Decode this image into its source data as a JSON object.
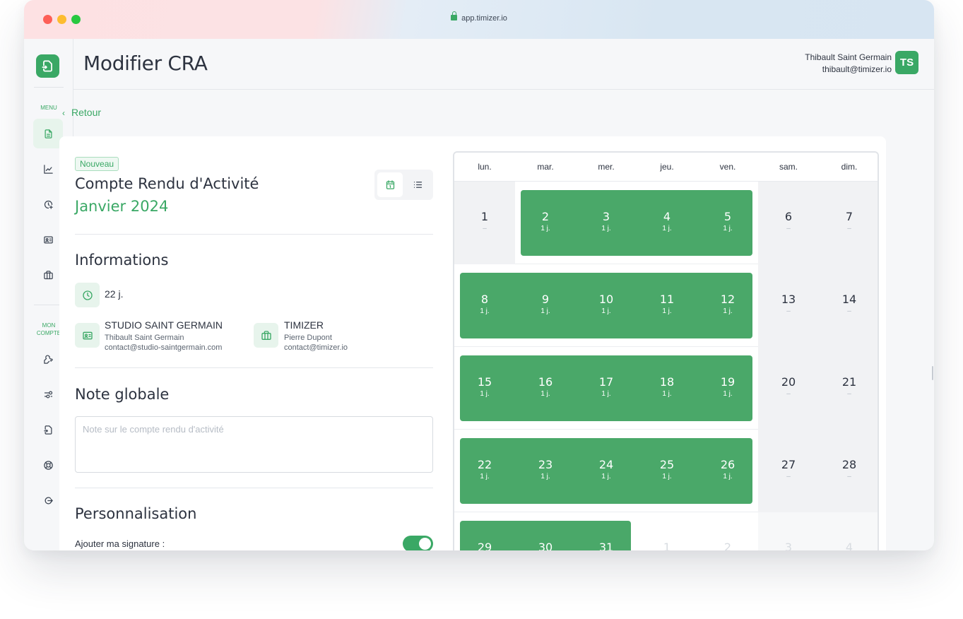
{
  "browser": {
    "url": "app.timizer.io"
  },
  "sidebar": {
    "menu_label": "MENU",
    "account_label_line1": "MON",
    "account_label_line2": "COMPTE",
    "menu_icons": [
      "document-icon",
      "chart-icon",
      "clock-plus-icon",
      "id-card-icon",
      "briefcase-icon"
    ],
    "account_icons": [
      "wrench-icon",
      "sliders-icon",
      "logo-icon",
      "lifebuoy-icon",
      "logout-icon"
    ]
  },
  "header": {
    "title": "Modifier CRA",
    "user_name": "Thibault Saint Germain",
    "user_email": "thibault@timizer.io",
    "avatar_initials": "TS"
  },
  "back_label": "Retour",
  "report": {
    "badge": "Nouveau",
    "title": "Compte Rendu d'Activité",
    "month": "Janvier 2024"
  },
  "informations": {
    "heading": "Informations",
    "days_total": "22 j.",
    "client": {
      "name": "STUDIO SAINT GERMAIN",
      "contact": "Thibault Saint Germain",
      "email": "contact@studio-saintgermain.com"
    },
    "provider": {
      "name": "TIMIZER",
      "contact": "Pierre Dupont",
      "email": "contact@timizer.io"
    }
  },
  "note": {
    "heading": "Note globale",
    "placeholder": "Note sur le compte rendu d'activité",
    "value": ""
  },
  "personalisation": {
    "heading": "Personnalisation",
    "signature_label": "Ajouter ma signature :",
    "signature_enabled": true
  },
  "calendar": {
    "weekdays": [
      "lun.",
      "mar.",
      "mer.",
      "jeu.",
      "ven.",
      "sam.",
      "dim."
    ],
    "weeks": [
      [
        {
          "d": "1",
          "v": "–",
          "on": false
        },
        {
          "d": "2",
          "v": "1 j.",
          "on": true
        },
        {
          "d": "3",
          "v": "1 j.",
          "on": true
        },
        {
          "d": "4",
          "v": "1 j.",
          "on": true
        },
        {
          "d": "5",
          "v": "1 j.",
          "on": true
        },
        {
          "d": "6",
          "v": "–",
          "on": false
        },
        {
          "d": "7",
          "v": "–",
          "on": false
        }
      ],
      [
        {
          "d": "8",
          "v": "1 j.",
          "on": true
        },
        {
          "d": "9",
          "v": "1 j.",
          "on": true
        },
        {
          "d": "10",
          "v": "1 j.",
          "on": true
        },
        {
          "d": "11",
          "v": "1 j.",
          "on": true
        },
        {
          "d": "12",
          "v": "1 j.",
          "on": true
        },
        {
          "d": "13",
          "v": "–",
          "on": false
        },
        {
          "d": "14",
          "v": "–",
          "on": false
        }
      ],
      [
        {
          "d": "15",
          "v": "1 j.",
          "on": true
        },
        {
          "d": "16",
          "v": "1 j.",
          "on": true
        },
        {
          "d": "17",
          "v": "1 j.",
          "on": true
        },
        {
          "d": "18",
          "v": "1 j.",
          "on": true
        },
        {
          "d": "19",
          "v": "1 j.",
          "on": true
        },
        {
          "d": "20",
          "v": "–",
          "on": false
        },
        {
          "d": "21",
          "v": "–",
          "on": false
        }
      ],
      [
        {
          "d": "22",
          "v": "1 j.",
          "on": true
        },
        {
          "d": "23",
          "v": "1 j.",
          "on": true
        },
        {
          "d": "24",
          "v": "1 j.",
          "on": true
        },
        {
          "d": "25",
          "v": "1 j.",
          "on": true
        },
        {
          "d": "26",
          "v": "1 j.",
          "on": true
        },
        {
          "d": "27",
          "v": "–",
          "on": false
        },
        {
          "d": "28",
          "v": "–",
          "on": false
        }
      ],
      [
        {
          "d": "29",
          "v": "",
          "on": true
        },
        {
          "d": "30",
          "v": "",
          "on": true
        },
        {
          "d": "31",
          "v": "",
          "on": true
        },
        {
          "d": "1",
          "v": "",
          "on": false,
          "other": true
        },
        {
          "d": "2",
          "v": "",
          "on": false,
          "other": true
        },
        {
          "d": "3",
          "v": "",
          "on": false,
          "other": true
        },
        {
          "d": "4",
          "v": "",
          "on": false,
          "other": true
        }
      ]
    ]
  },
  "colors": {
    "accent": "#3aa865",
    "band": "#4aa869"
  }
}
